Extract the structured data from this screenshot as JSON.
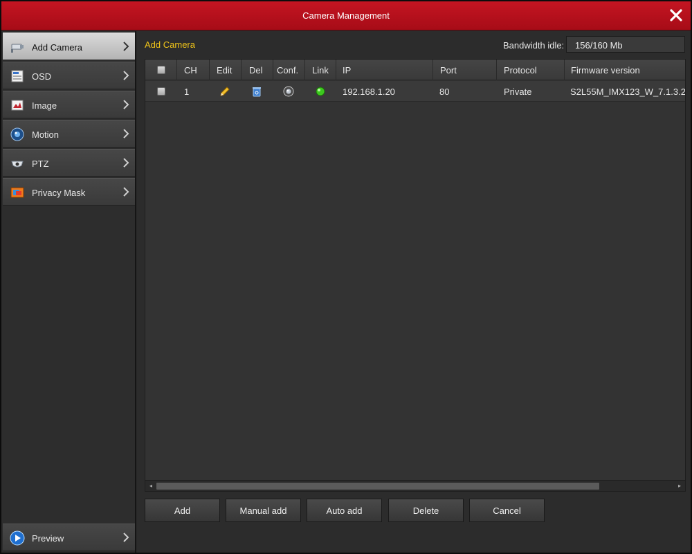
{
  "window": {
    "title": "Camera Management"
  },
  "sidebar": {
    "items": [
      {
        "label": "Add Camera",
        "icon": "camera-icon",
        "active": true
      },
      {
        "label": "OSD",
        "icon": "osd-icon"
      },
      {
        "label": "Image",
        "icon": "image-icon"
      },
      {
        "label": "Motion",
        "icon": "motion-icon"
      },
      {
        "label": "PTZ",
        "icon": "ptz-icon"
      },
      {
        "label": "Privacy Mask",
        "icon": "privacy-mask-icon"
      }
    ],
    "preview": {
      "label": "Preview",
      "icon": "play-icon"
    }
  },
  "main": {
    "section_title": "Add Camera",
    "bandwidth": {
      "label": "Bandwidth idle:",
      "value": "156/160 Mb"
    }
  },
  "table": {
    "columns": [
      "CH",
      "Edit",
      "Del",
      "Conf.",
      "Link",
      "IP",
      "Port",
      "Protocol",
      "Firmware version"
    ],
    "rows": [
      {
        "ch": "1",
        "ip": "192.168.1.20",
        "port": "80",
        "protocol": "Private",
        "firmware": "S2L55M_IMX123_W_7.1.3.2",
        "link_status": "connected",
        "link_color": "#3cc81e"
      }
    ]
  },
  "buttons": {
    "add": "Add",
    "manual_add": "Manual add",
    "auto_add": "Auto add",
    "delete": "Delete",
    "cancel": "Cancel"
  },
  "colors": {
    "titlebar": "#b71120",
    "accent_text": "#f0c419"
  }
}
